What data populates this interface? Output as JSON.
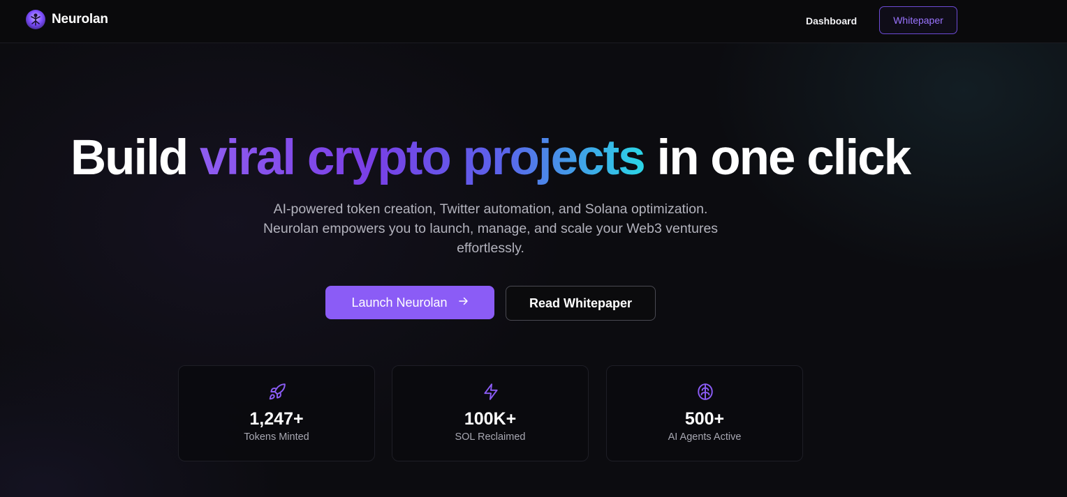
{
  "nav": {
    "brand": "Neurolan",
    "links": {
      "dashboard": "Dashboard",
      "whitepaper": "Whitepaper"
    }
  },
  "hero": {
    "headline": {
      "part1": "Build",
      "highlight": "viral crypto projects",
      "part2": "in one click"
    },
    "subtitle_lines": [
      "AI-powered token creation, Twitter automation, and Solana optimization.",
      "Neurolan empowers you to launch, manage, and scale your Web3 ventures",
      "effortlessly."
    ],
    "cta_primary": "Launch Neurolan",
    "cta_primary_icon": "arrow-right-icon",
    "cta_secondary": "Read Whitepaper"
  },
  "stats": [
    {
      "icon": "rocket-icon",
      "value": "1,247+",
      "label": "Tokens Minted"
    },
    {
      "icon": "lightning-icon",
      "value": "100K+",
      "label": "SOL Reclaimed"
    },
    {
      "icon": "brain-icon",
      "value": "500+",
      "label": "AI Agents Active"
    }
  ],
  "colors": {
    "accent": "#8b5cf6",
    "gradient_start": "#8f5df0",
    "gradient_end": "#2bd6e6",
    "background": "#0c0c10"
  }
}
